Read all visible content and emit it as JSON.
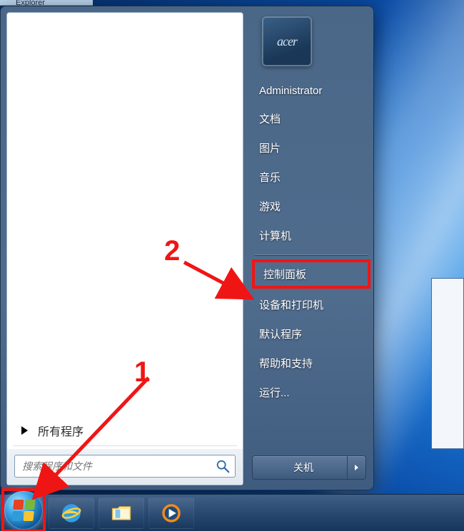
{
  "window_fragment_title": "Explorer",
  "user_picture_brand": "acer",
  "right_panel": {
    "user": "Administrator",
    "documents": "文档",
    "pictures": "图片",
    "music": "音乐",
    "games": "游戏",
    "computer": "计算机",
    "control_panel": "控制面板",
    "devices_printers": "设备和打印机",
    "default_programs": "默认程序",
    "help": "帮助和支持",
    "run": "运行..."
  },
  "all_programs_label": "所有程序",
  "search": {
    "placeholder": "搜索程序和文件"
  },
  "shutdown_label": "关机",
  "annotations": {
    "step1": "1",
    "step2": "2"
  }
}
